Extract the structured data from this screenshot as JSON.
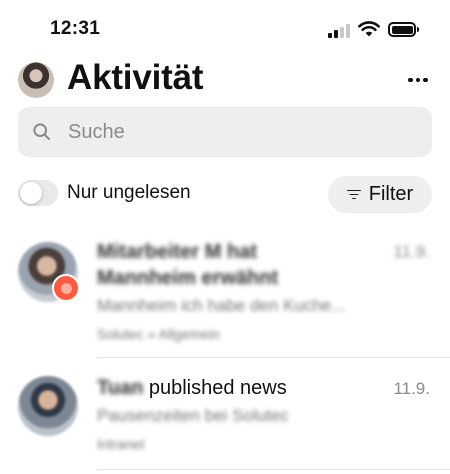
{
  "status_bar": {
    "time": "12:31"
  },
  "header": {
    "title": "Aktivität"
  },
  "search": {
    "placeholder": "Suche"
  },
  "filters": {
    "toggle_label": "Nur ungelesen",
    "unread_only": false,
    "filter_label": "Filter"
  },
  "activities": [
    {
      "title_line1": "Mitarbeiter M hat",
      "title_line2": "Mannheim erwähnt",
      "date": "11.9.",
      "preview": "Mannheim ich habe den Kuche...",
      "meta": "Solutec » Allgemein",
      "unread": true
    },
    {
      "actor": "Tuan",
      "action": "published news",
      "date": "11.9.",
      "preview": "Pausenzeiten bei Solutec",
      "meta": "Intranet"
    }
  ]
}
